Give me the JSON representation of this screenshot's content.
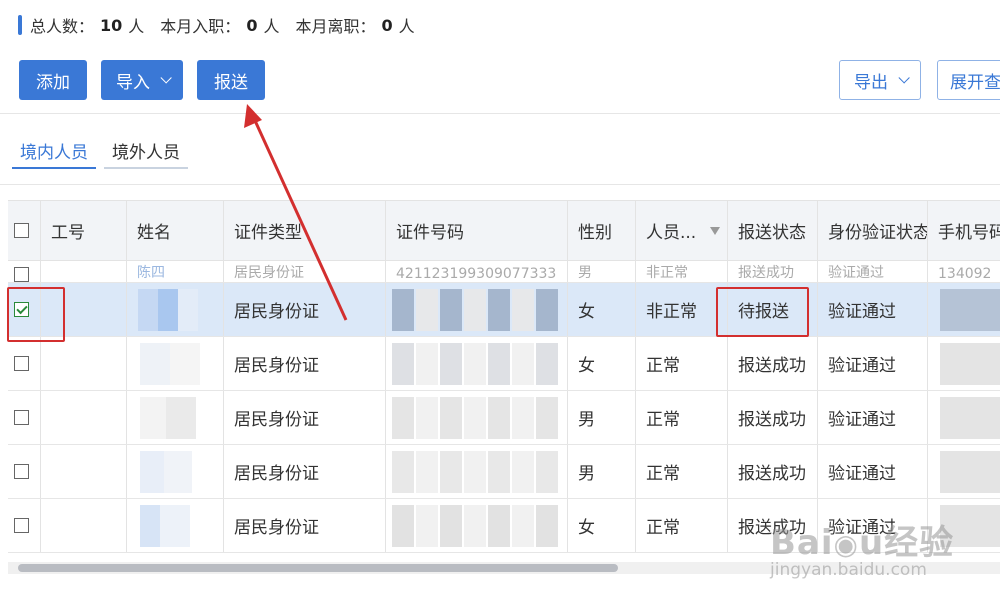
{
  "stats": {
    "total_label": "总人数：",
    "total_value": "10",
    "total_unit": "人",
    "joined_label": "本月入职：",
    "joined_value": "0",
    "joined_unit": "人",
    "left_label": "本月离职：",
    "left_value": "0",
    "left_unit": "人"
  },
  "toolbar": {
    "add_label": "添加",
    "import_label": "导入",
    "report_label": "报送",
    "export_label": "导出",
    "expand_label": "展开查"
  },
  "tabs": [
    {
      "label": "境内人员",
      "active": true
    },
    {
      "label": "境外人员",
      "active": false
    }
  ],
  "table": {
    "headers": {
      "emp_no": "工号",
      "name": "姓名",
      "id_type": "证件类型",
      "id_number": "证件号码",
      "gender": "性别",
      "staff_status": "人员...",
      "report_status": "报送状态",
      "verify_status": "身份验证状态",
      "phone": "手机号码"
    },
    "partial_row": {
      "name": "陈四",
      "id_type": "居民身份证",
      "id_number": "421123199309077333",
      "gender": "男",
      "staff_status": "非正常",
      "report_status": "报送成功",
      "verify_status": "验证通过",
      "phone": "134092"
    },
    "rows": [
      {
        "checked": true,
        "id_type": "居民身份证",
        "gender": "女",
        "staff_status": "非正常",
        "report_status": "待报送",
        "verify_status": "验证通过"
      },
      {
        "checked": false,
        "id_type": "居民身份证",
        "gender": "女",
        "staff_status": "正常",
        "report_status": "报送成功",
        "verify_status": "验证通过"
      },
      {
        "checked": false,
        "id_type": "居民身份证",
        "gender": "男",
        "staff_status": "正常",
        "report_status": "报送成功",
        "verify_status": "验证通过"
      },
      {
        "checked": false,
        "id_type": "居民身份证",
        "gender": "男",
        "staff_status": "正常",
        "report_status": "报送成功",
        "verify_status": "验证通过"
      },
      {
        "checked": false,
        "id_type": "居民身份证",
        "gender": "女",
        "staff_status": "正常",
        "report_status": "报送成功",
        "verify_status": "验证通过"
      }
    ]
  },
  "watermark": {
    "logo": "Baidu经验",
    "url": "jingyan.baidu.com"
  },
  "colors": {
    "accent": "#3a78d6",
    "annotation": "#d32f2f",
    "selected_row": "#dbe8f8"
  }
}
